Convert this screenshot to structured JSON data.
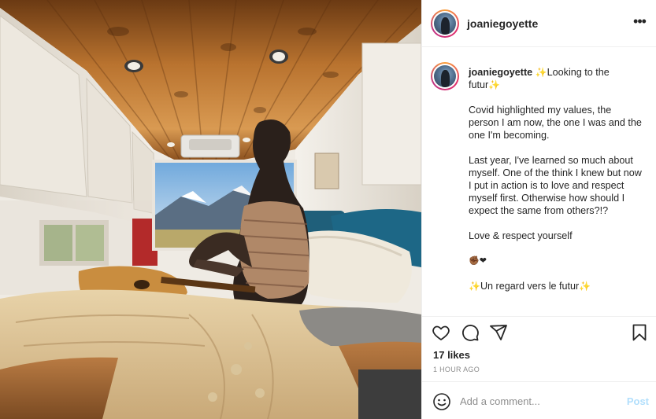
{
  "post": {
    "image_alt": "",
    "username": "joaniegoyette",
    "more_icon": "more-options-icon",
    "caption": {
      "username": "joaniegoyette",
      "line1": "Looking to the futur",
      "para1": "Covid highlighted my values, the person I am now, the one I was and the one I'm becoming.",
      "para2": "Last year, I've learned so much about myself. One of the think I knew but now I put in action is to love and respect myself first. Otherwise how should I expect the same from others?!?",
      "para3": "Love & respect yourself",
      "emoji_line": "✊🏾❤",
      "last_line": "Un regard vers le futur",
      "sparkle": "✨"
    },
    "likes": "17 likes",
    "time": "1 HOUR AGO",
    "comment_placeholder": "Add a comment...",
    "post_label": "Post",
    "icons": {
      "like": "heart-icon",
      "comment": "comment-icon",
      "share": "share-icon",
      "save": "bookmark-icon",
      "emoji": "smiley-icon"
    },
    "colors": {
      "text": "#262626",
      "muted": "#8e8e8e",
      "post_button": "#b2dffc",
      "border": "#efefef"
    }
  }
}
